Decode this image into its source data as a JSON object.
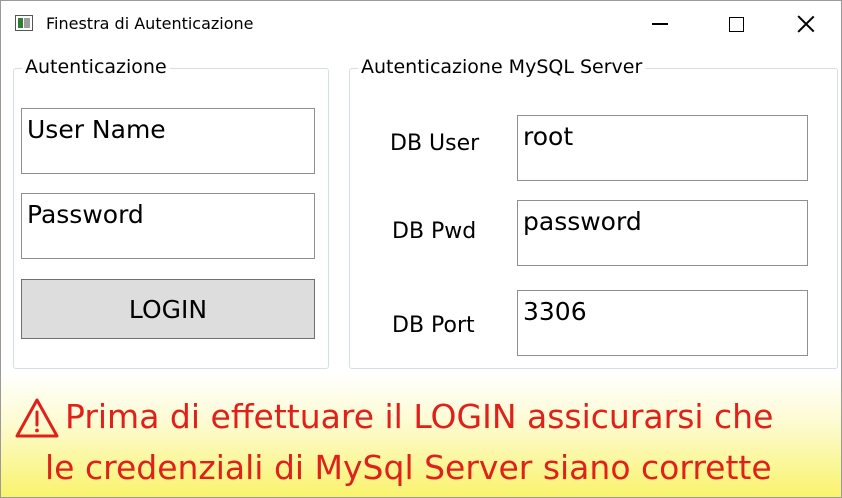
{
  "window": {
    "title": "Finestra di Autenticazione",
    "controls": {
      "minimize_icon": "minimize-icon",
      "maximize_icon": "maximize-icon",
      "close_icon": "close-icon"
    }
  },
  "auth_group": {
    "legend": "Autenticazione",
    "username_value": "User Name",
    "password_value": "Password",
    "login_label": "LOGIN"
  },
  "mysql_group": {
    "legend": "Autenticazione MySQL Server",
    "fields": [
      {
        "label": "DB User",
        "value": "root"
      },
      {
        "label": "DB Pwd",
        "value": "password"
      },
      {
        "label": "DB Port",
        "value": "3306"
      }
    ]
  },
  "banner": {
    "icon": "warning-icon",
    "line1": "Prima di effettuare il LOGIN assicurarsi che",
    "line2": "le credenziali di MySql Server siano corrette",
    "text_color": "#e0201b"
  },
  "colors": {
    "banner_gradient_end": "#f9f36a",
    "button_bg": "#dddddd",
    "groupbox_border": "#d5dfe5"
  }
}
